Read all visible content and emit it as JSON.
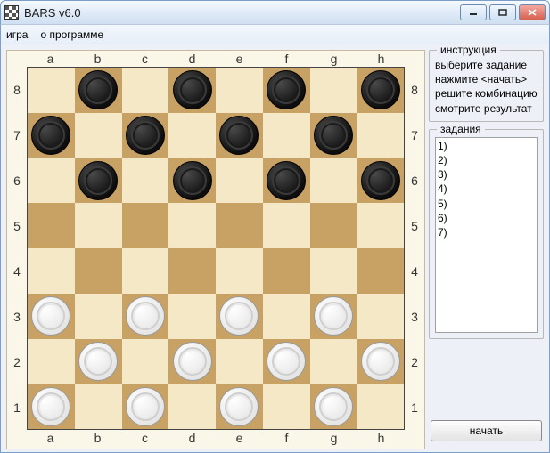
{
  "window": {
    "title": "BARS v6.0"
  },
  "menu": {
    "game": "игра",
    "about": "о программе"
  },
  "board": {
    "files": [
      "a",
      "b",
      "c",
      "d",
      "e",
      "f",
      "g",
      "h"
    ],
    "ranks": [
      "8",
      "7",
      "6",
      "5",
      "4",
      "3",
      "2",
      "1"
    ],
    "pieces": [
      {
        "file": "b",
        "rank": 8,
        "color": "black"
      },
      {
        "file": "d",
        "rank": 8,
        "color": "black"
      },
      {
        "file": "f",
        "rank": 8,
        "color": "black"
      },
      {
        "file": "h",
        "rank": 8,
        "color": "black"
      },
      {
        "file": "a",
        "rank": 7,
        "color": "black"
      },
      {
        "file": "c",
        "rank": 7,
        "color": "black"
      },
      {
        "file": "e",
        "rank": 7,
        "color": "black"
      },
      {
        "file": "g",
        "rank": 7,
        "color": "black"
      },
      {
        "file": "b",
        "rank": 6,
        "color": "black"
      },
      {
        "file": "d",
        "rank": 6,
        "color": "black"
      },
      {
        "file": "f",
        "rank": 6,
        "color": "black"
      },
      {
        "file": "h",
        "rank": 6,
        "color": "black"
      },
      {
        "file": "a",
        "rank": 3,
        "color": "white"
      },
      {
        "file": "c",
        "rank": 3,
        "color": "white"
      },
      {
        "file": "e",
        "rank": 3,
        "color": "white"
      },
      {
        "file": "g",
        "rank": 3,
        "color": "white"
      },
      {
        "file": "b",
        "rank": 2,
        "color": "white"
      },
      {
        "file": "d",
        "rank": 2,
        "color": "white"
      },
      {
        "file": "f",
        "rank": 2,
        "color": "white"
      },
      {
        "file": "h",
        "rank": 2,
        "color": "white"
      },
      {
        "file": "a",
        "rank": 1,
        "color": "white"
      },
      {
        "file": "c",
        "rank": 1,
        "color": "white"
      },
      {
        "file": "e",
        "rank": 1,
        "color": "white"
      },
      {
        "file": "g",
        "rank": 1,
        "color": "white"
      }
    ]
  },
  "instructions": {
    "title": "инструкция",
    "lines": [
      "выберите задание",
      "нажмите <начать>",
      "решите комбинацию",
      "смотрите результат"
    ]
  },
  "tasks": {
    "title": "задания",
    "items": [
      "1)",
      "2)",
      "3)",
      "4)",
      "5)",
      "6)",
      "7)"
    ]
  },
  "buttons": {
    "start": "начать"
  }
}
